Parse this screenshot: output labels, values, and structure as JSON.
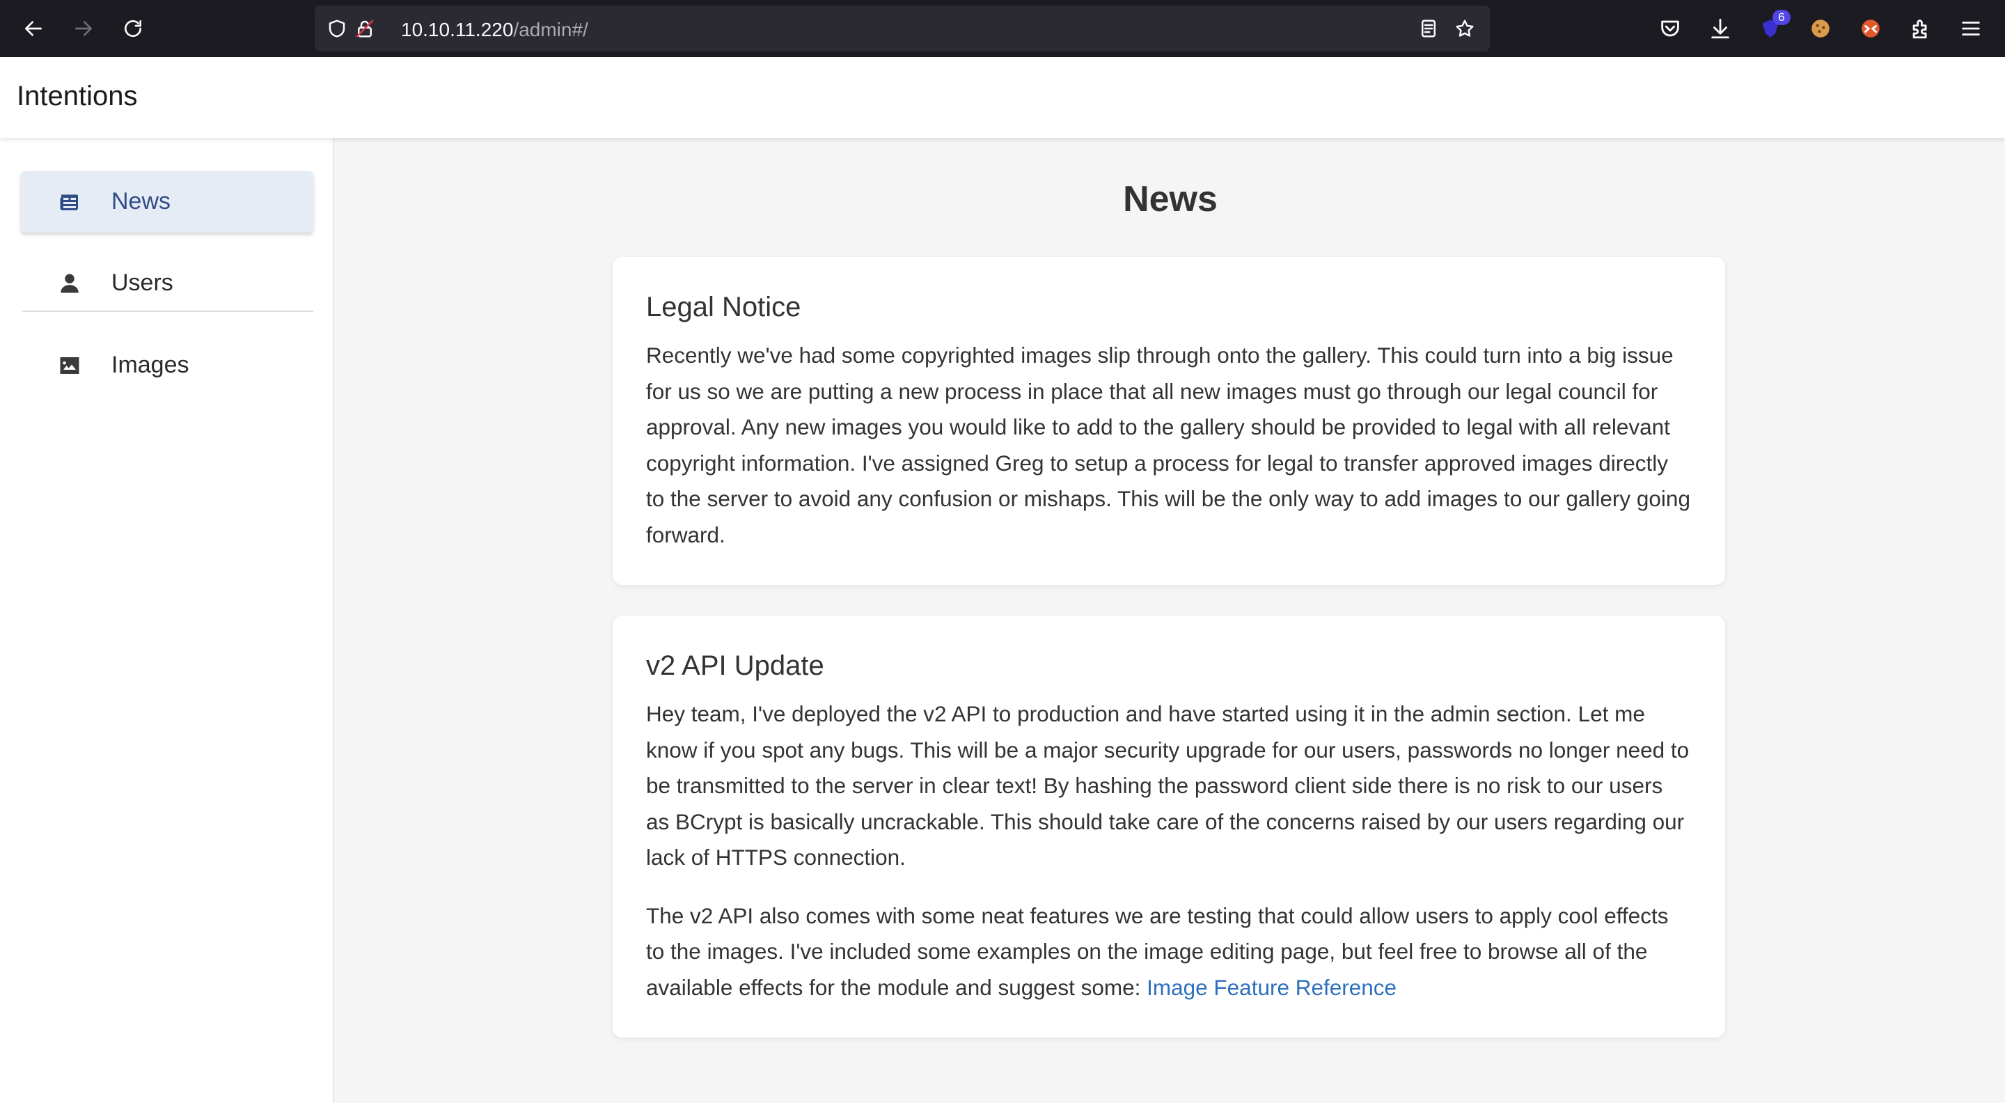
{
  "browser": {
    "url_host": "10.10.11.220",
    "url_path": "/admin#/",
    "extension_badge": "6",
    "icons": {
      "back": "arrow-left-icon",
      "forward": "arrow-right-icon",
      "reload": "reload-icon",
      "tracking_protection": "shield-icon",
      "insecure_lock": "lock-icon",
      "reader": "reader-view-icon",
      "bookmark": "star-icon",
      "pocket": "pocket-icon",
      "downloads": "download-icon",
      "extension_purple": "extension-shield-icon",
      "cookie": "cookie-icon",
      "extension_orange": "extension-fox-icon",
      "extensions": "puzzle-icon",
      "menu": "hamburger-menu-icon"
    }
  },
  "app": {
    "title": "Intentions"
  },
  "sidebar": {
    "items": [
      {
        "label": "News",
        "icon": "newspaper-icon",
        "active": true
      },
      {
        "label": "Users",
        "icon": "user-icon",
        "active": false
      },
      {
        "label": "Images",
        "icon": "image-icon",
        "active": false
      }
    ]
  },
  "main": {
    "heading": "News",
    "cards": [
      {
        "title": "Legal Notice",
        "paragraphs": [
          "Recently we've had some copyrighted images slip through onto the gallery. This could turn into a big issue for us so we are putting a new process in place that all new images must go through our legal council for approval. Any new images you would like to add to the gallery should be provided to legal with all relevant copyright information. I've assigned Greg to setup a process for legal to transfer approved images directly to the server to avoid any confusion or mishaps. This will be the only way to add images to our gallery going forward."
        ]
      },
      {
        "title": "v2 API Update",
        "paragraphs": [
          "Hey team, I've deployed the v2 API to production and have started using it in the admin section. Let me know if you spot any bugs. This will be a major security upgrade for our users, passwords no longer need to be transmitted to the server in clear text! By hashing the password client side there is no risk to our users as BCrypt is basically uncrackable. This should take care of the concerns raised by our users regarding our lack of HTTPS connection.",
          "The v2 API also comes with some neat features we are testing that could allow users to apply cool effects to the images. I've included some examples on the image editing page, but feel free to browse all of the available effects for the module and suggest some: "
        ],
        "link_text": "Image Feature Reference"
      }
    ]
  },
  "colors": {
    "accent": "#2f4c86",
    "link": "#2f6fbf",
    "active_bg": "#e6ecf6",
    "browser_bg": "#1c1b22"
  }
}
